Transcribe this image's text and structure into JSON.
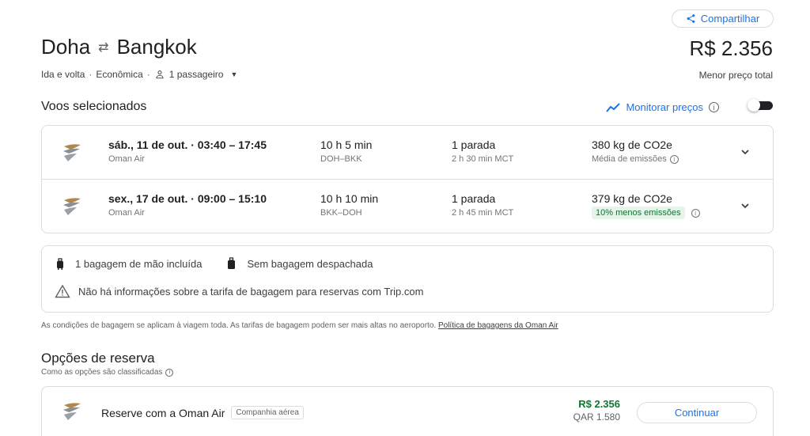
{
  "header": {
    "share_label": "Compartilhar",
    "origin": "Doha",
    "destination": "Bangkok",
    "trip_type": "Ida e volta",
    "cabin": "Econômica",
    "passengers": "1 passageiro",
    "price": "R$ 2.356",
    "price_caption": "Menor preço total"
  },
  "selected": {
    "title": "Voos selecionados",
    "track_label": "Monitorar preços",
    "track_enabled": false,
    "flights": [
      {
        "date_time": "sáb., 11 de out. · 03:40 – 17:45",
        "airline": "Oman Air",
        "duration": "10 h 5 min",
        "route": "DOH–BKK",
        "stops": "1 parada",
        "layover": "2 h 30 min MCT",
        "emissions": "380 kg de CO2e",
        "emissions_note": "Média de emissões"
      },
      {
        "date_time": "sex., 17 de out. · 09:00 – 15:10",
        "airline": "Oman Air",
        "duration": "10 h 10 min",
        "route": "BKK–DOH",
        "stops": "1 parada",
        "layover": "2 h 45 min MCT",
        "emissions": "379 kg de CO2e",
        "emissions_note": "10% menos emissões"
      }
    ]
  },
  "baggage": {
    "carry_on": "1 bagagem de mão incluída",
    "checked": "Sem bagagem despachada",
    "warning": "Não há informações sobre a tarifa de bagagem para reservas com Trip.com",
    "note": "As condições de bagagem se aplicam à viagem toda. As tarifas de bagagem podem ser mais altas no aeroporto.",
    "policy_link": "Política de bagagens da Oman Air"
  },
  "booking": {
    "title": "Opções de reserva",
    "subtitle": "Como as opções são classificadas",
    "offers": [
      {
        "label": "Reserve com a Oman Air",
        "tag": "Companhia aérea",
        "price": "R$ 2.356",
        "price_local": "QAR 1.580",
        "button": "Continuar"
      }
    ]
  },
  "colors": {
    "accent": "#1a73e8",
    "green": "#137333",
    "green_bg": "#e6f4ea",
    "border": "#dadce0"
  }
}
